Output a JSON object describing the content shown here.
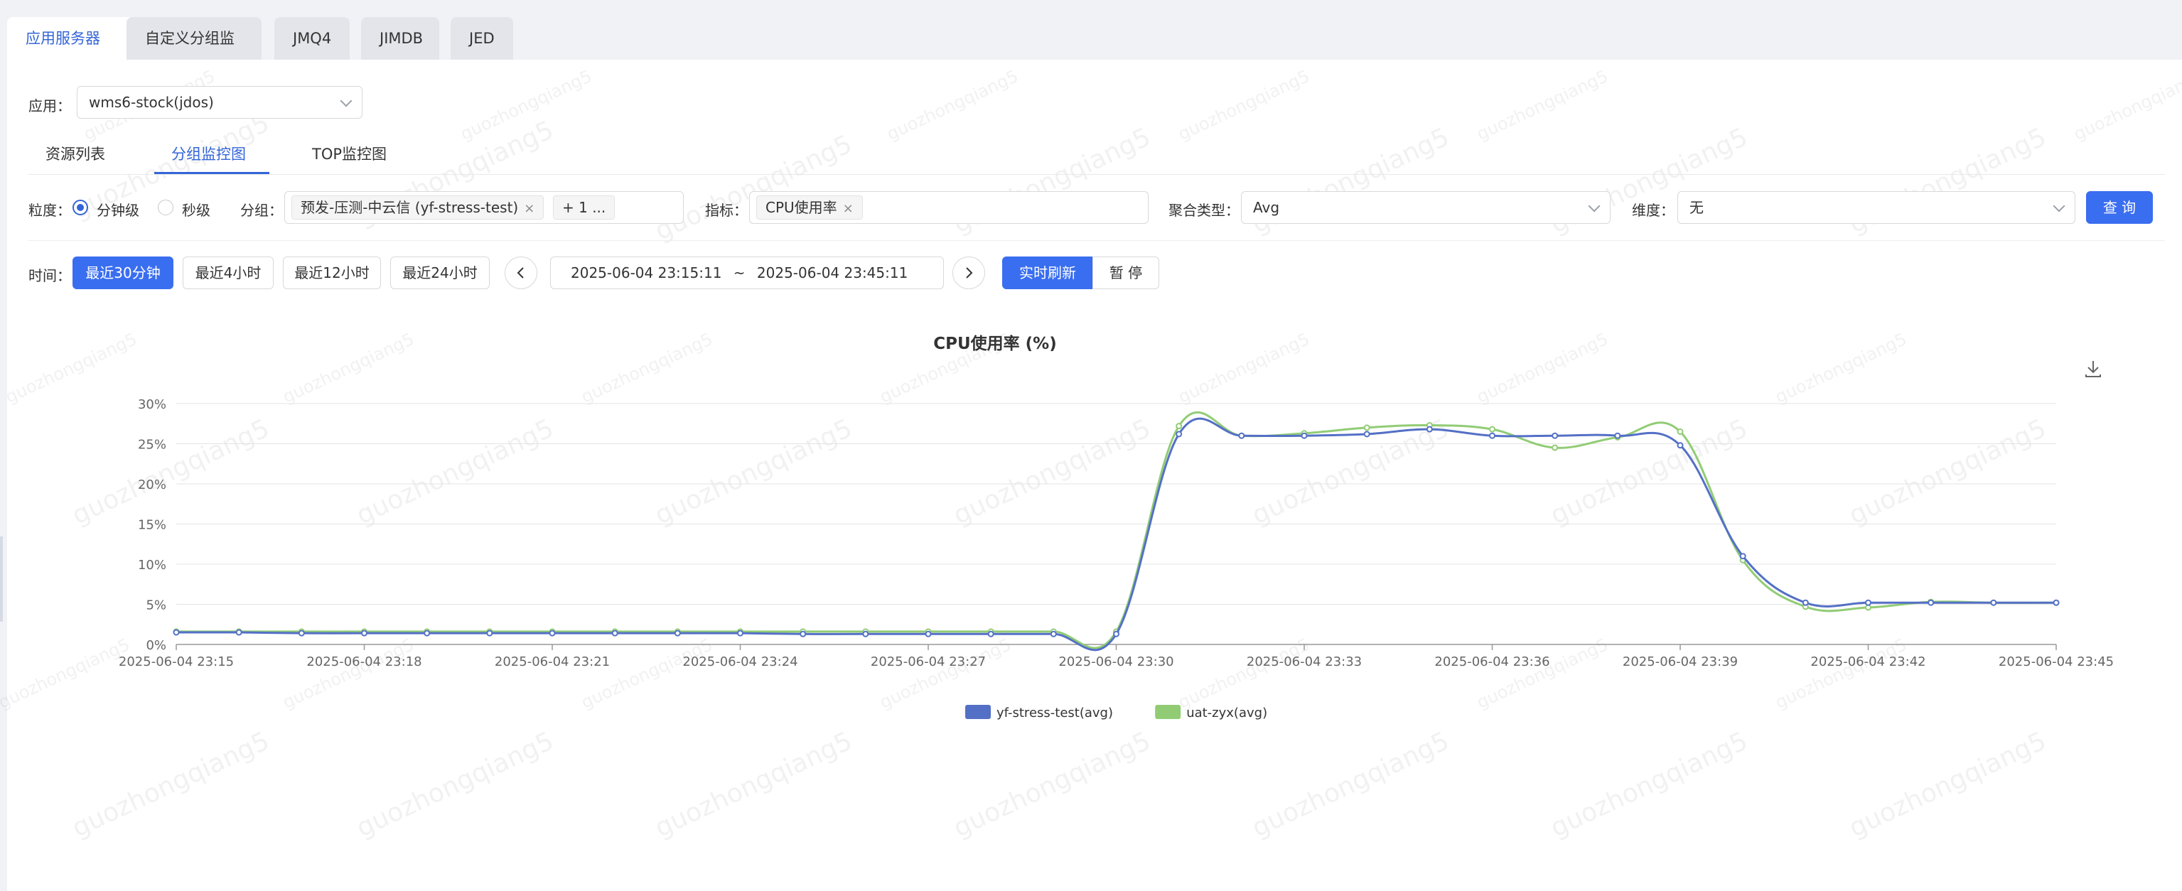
{
  "app_tabs": [
    "应用服务器",
    "自定义分组监控",
    "JMQ4",
    "JIMDB",
    "JED"
  ],
  "app_select": {
    "label": "应用：",
    "value": "wms6-stock(jdos)"
  },
  "sub_tabs": [
    "资源列表",
    "分组监控图",
    "TOP监控图"
  ],
  "filters": {
    "granularity_label": "粒度：",
    "granularity_options": [
      "分钟级",
      "秒级"
    ],
    "group_label": "分组：",
    "group_tag": "预发-压测-中云信 (yf-stress-test)",
    "group_more": "+ 1 ...",
    "metric_label": "指标：",
    "metric_tag": "CPU使用率",
    "agg_label": "聚合类型：",
    "agg_value": "Avg",
    "dim_label": "维度：",
    "dim_value": "无",
    "query_button": "查 询"
  },
  "time": {
    "label": "时间：",
    "quick": [
      "最近30分钟",
      "最近4小时",
      "最近12小时",
      "最近24小时"
    ],
    "start": "2025-06-04 23:15:11",
    "sep": "~",
    "end": "2025-06-04 23:45:11",
    "refresh": "实时刷新",
    "pause": "暂 停"
  },
  "watermark": "guozhongqiang5",
  "chart_data": {
    "type": "line",
    "title": "CPU使用率 (%)",
    "xlabel": "",
    "ylabel": "",
    "ylim": [
      0,
      30
    ],
    "yticks": [
      "0%",
      "5%",
      "10%",
      "15%",
      "20%",
      "25%",
      "30%"
    ],
    "x_tick_labels": [
      "2025-06-04 23:15",
      "2025-06-04 23:18",
      "2025-06-04 23:21",
      "2025-06-04 23:24",
      "2025-06-04 23:27",
      "2025-06-04 23:30",
      "2025-06-04 23:33",
      "2025-06-04 23:36",
      "2025-06-04 23:39",
      "2025-06-04 23:42",
      "2025-06-04 23:45"
    ],
    "x": [
      "23:15",
      "23:16",
      "23:17",
      "23:18",
      "23:19",
      "23:20",
      "23:21",
      "23:22",
      "23:23",
      "23:24",
      "23:25",
      "23:26",
      "23:27",
      "23:28",
      "23:29",
      "23:30",
      "23:31",
      "23:32",
      "23:33",
      "23:34",
      "23:35",
      "23:36",
      "23:37",
      "23:38",
      "23:39",
      "23:40",
      "23:41",
      "23:42",
      "23:43",
      "23:44",
      "23:45"
    ],
    "grid": true,
    "legend": "bottom",
    "series": [
      {
        "name": "yf-stress-test(avg)",
        "color": "#5470c6",
        "values": [
          1.5,
          1.5,
          1.4,
          1.4,
          1.4,
          1.4,
          1.4,
          1.4,
          1.4,
          1.4,
          1.3,
          1.3,
          1.3,
          1.3,
          1.3,
          1.3,
          26.2,
          26.0,
          26.0,
          26.2,
          26.8,
          26.0,
          26.0,
          26.0,
          24.8,
          11.0,
          5.2,
          5.2,
          5.2,
          5.2,
          5.2
        ]
      },
      {
        "name": "uat-zyx(avg)",
        "color": "#91cc75",
        "values": [
          1.6,
          1.6,
          1.6,
          1.6,
          1.6,
          1.6,
          1.6,
          1.6,
          1.6,
          1.6,
          1.6,
          1.6,
          1.6,
          1.6,
          1.6,
          1.6,
          27.2,
          26.0,
          26.3,
          27.0,
          27.3,
          26.8,
          24.5,
          25.8,
          26.5,
          10.5,
          4.7,
          4.6,
          5.3,
          5.2,
          5.2
        ]
      }
    ]
  }
}
